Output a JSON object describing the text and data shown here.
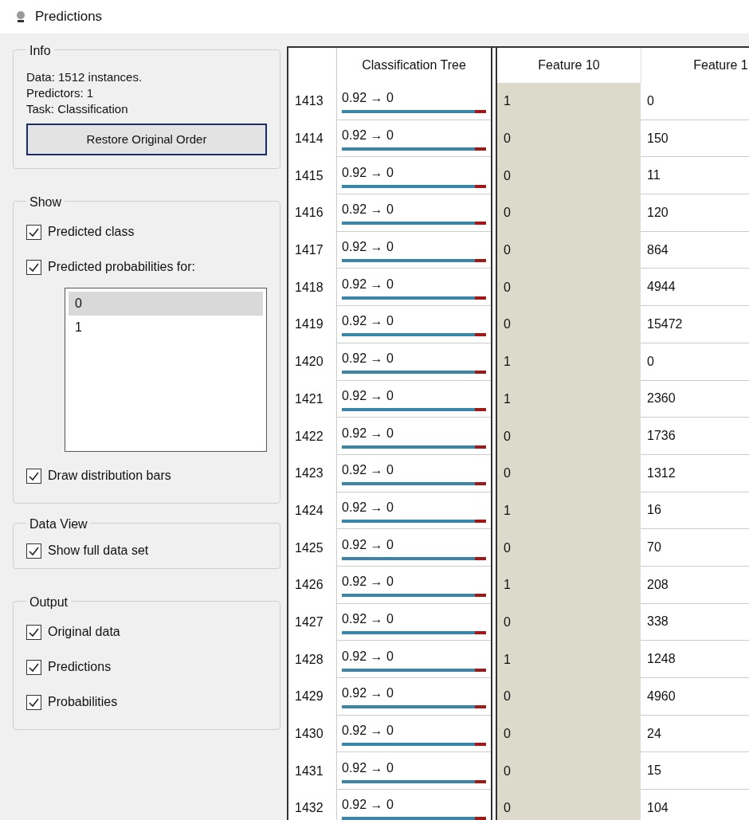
{
  "window": {
    "title": "Predictions"
  },
  "info": {
    "title": "Info",
    "lines": [
      "Data: 1512 instances.",
      "Predictors: 1",
      "Task: Classification"
    ],
    "button": "Restore Original Order"
  },
  "show": {
    "title": "Show",
    "options": [
      {
        "label": "Predicted class",
        "checked": true
      },
      {
        "label": "Predicted probabilities for:",
        "checked": true
      }
    ],
    "classes": [
      {
        "label": "0",
        "selected": true
      },
      {
        "label": "1",
        "selected": false
      }
    ],
    "bars_option": {
      "label": "Draw distribution bars",
      "checked": true
    }
  },
  "data_view": {
    "title": "Data View",
    "options": [
      {
        "label": "Show full data set",
        "checked": true
      }
    ]
  },
  "output": {
    "title": "Output",
    "options": [
      {
        "label": "Original data",
        "checked": true
      },
      {
        "label": "Predictions",
        "checked": true
      },
      {
        "label": "Probabilities",
        "checked": true
      }
    ]
  },
  "predictions_table": {
    "columns": [
      "Classification Tree"
    ],
    "rows": [
      {
        "index": "1413",
        "prediction": "0.92 → 0",
        "level": 0.92
      },
      {
        "index": "1414",
        "prediction": "0.92 → 0",
        "level": 0.92
      },
      {
        "index": "1415",
        "prediction": "0.92 → 0",
        "level": 0.92
      },
      {
        "index": "1416",
        "prediction": "0.92 → 0",
        "level": 0.92
      },
      {
        "index": "1417",
        "prediction": "0.92 → 0",
        "level": 0.92
      },
      {
        "index": "1418",
        "prediction": "0.92 → 0",
        "level": 0.92
      },
      {
        "index": "1419",
        "prediction": "0.92 → 0",
        "level": 0.92
      },
      {
        "index": "1420",
        "prediction": "0.92 → 0",
        "level": 0.92
      },
      {
        "index": "1421",
        "prediction": "0.92 → 0",
        "level": 0.92
      },
      {
        "index": "1422",
        "prediction": "0.92 → 0",
        "level": 0.92
      },
      {
        "index": "1423",
        "prediction": "0.92 → 0",
        "level": 0.92
      },
      {
        "index": "1424",
        "prediction": "0.92 → 0",
        "level": 0.92
      },
      {
        "index": "1425",
        "prediction": "0.92 → 0",
        "level": 0.92
      },
      {
        "index": "1426",
        "prediction": "0.92 → 0",
        "level": 0.92
      },
      {
        "index": "1427",
        "prediction": "0.92 → 0",
        "level": 0.92
      },
      {
        "index": "1428",
        "prediction": "0.92 → 0",
        "level": 0.92
      },
      {
        "index": "1429",
        "prediction": "0.92 → 0",
        "level": 0.92
      },
      {
        "index": "1430",
        "prediction": "0.92 → 0",
        "level": 0.92
      },
      {
        "index": "1431",
        "prediction": "0.92 → 0",
        "level": 0.92
      },
      {
        "index": "1432",
        "prediction": "0.92 → 0",
        "level": 0.92
      }
    ]
  },
  "data_table": {
    "columns": [
      "Feature 10",
      "Feature 1"
    ],
    "rows": [
      [
        "1",
        "0"
      ],
      [
        "0",
        "150"
      ],
      [
        "0",
        "11"
      ],
      [
        "0",
        "120"
      ],
      [
        "0",
        "864"
      ],
      [
        "0",
        "4944"
      ],
      [
        "0",
        "15472"
      ],
      [
        "1",
        "0"
      ],
      [
        "1",
        "2360"
      ],
      [
        "0",
        "1736"
      ],
      [
        "0",
        "1312"
      ],
      [
        "1",
        "16"
      ],
      [
        "0",
        "70"
      ],
      [
        "1",
        "208"
      ],
      [
        "0",
        "338"
      ],
      [
        "1",
        "1248"
      ],
      [
        "0",
        "4960"
      ],
      [
        "0",
        "24"
      ],
      [
        "0",
        "15"
      ],
      [
        "0",
        "104"
      ]
    ]
  }
}
